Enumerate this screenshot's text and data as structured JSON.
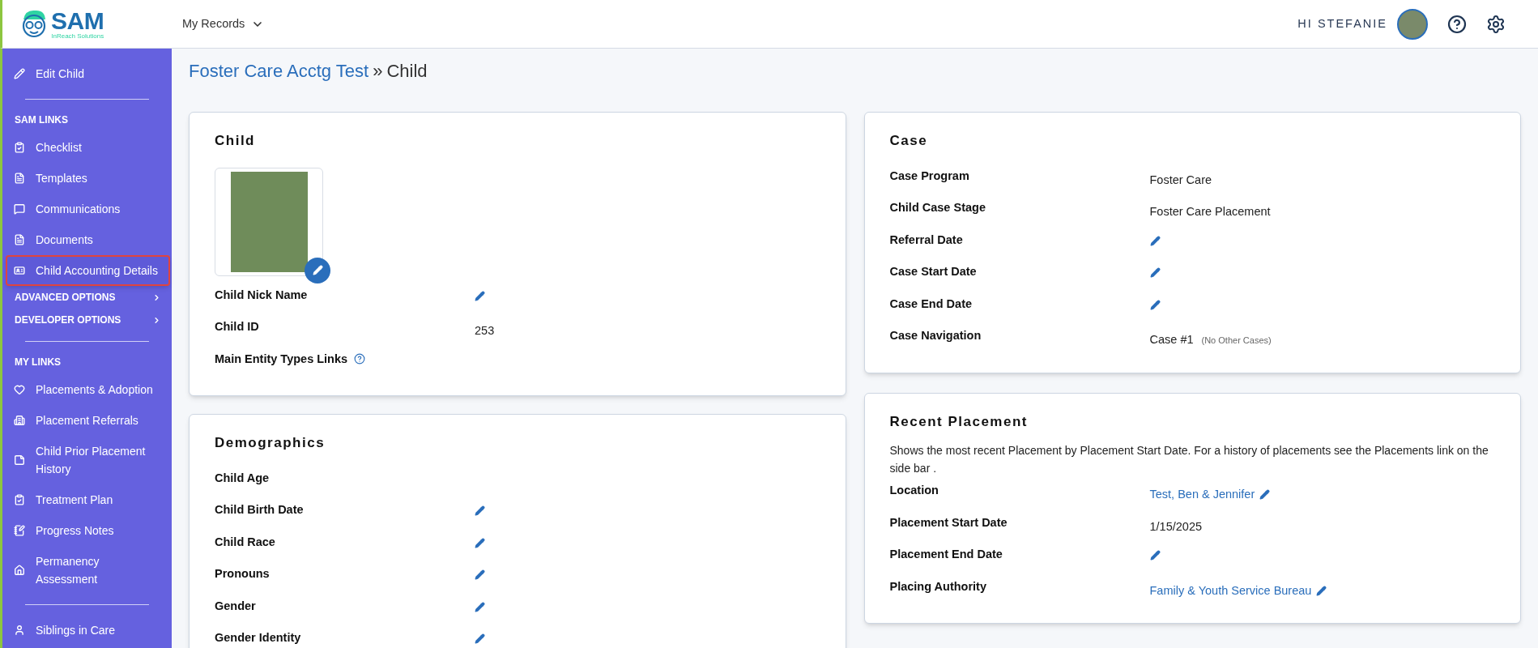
{
  "header": {
    "logo": {
      "name": "SAM",
      "tagline": "InReach Solutions"
    },
    "menu": "My Records",
    "greeting": "HI STEFANIE"
  },
  "sidebar": [
    {
      "kind": "link",
      "label": "Edit Child",
      "selected": false
    },
    {
      "kind": "divider"
    },
    {
      "kind": "heading",
      "label": "SAM LINKS"
    },
    {
      "kind": "link",
      "label": "Checklist",
      "selected": false
    },
    {
      "kind": "link",
      "label": "Templates",
      "selected": false
    },
    {
      "kind": "link",
      "label": "Communications",
      "selected": false
    },
    {
      "kind": "link",
      "label": "Documents",
      "selected": false
    },
    {
      "kind": "link",
      "label": "Child Accounting Details",
      "selected": true
    },
    {
      "kind": "expander",
      "label": "ADVANCED OPTIONS",
      "expanded": false
    },
    {
      "kind": "expander",
      "label": "DEVELOPER OPTIONS",
      "expanded": false
    },
    {
      "kind": "divider"
    },
    {
      "kind": "heading",
      "label": "MY LINKS"
    },
    {
      "kind": "link",
      "label": "Placements & Adoption",
      "selected": false
    },
    {
      "kind": "link",
      "label": "Placement Referrals",
      "selected": false
    },
    {
      "kind": "link",
      "label": "Child Prior Placement History",
      "selected": false
    },
    {
      "kind": "link",
      "label": "Treatment Plan",
      "selected": false
    },
    {
      "kind": "link",
      "label": "Progress Notes",
      "selected": false
    },
    {
      "kind": "link",
      "label": "Permanency Assessment",
      "selected": false
    },
    {
      "kind": "divider"
    },
    {
      "kind": "link",
      "label": "Siblings in Care",
      "selected": false
    }
  ],
  "breadcrumb": {
    "link": "Foster Care Acctg Test",
    "separator": "»",
    "current": "Child"
  },
  "left_cards": [
    {
      "title": "Child",
      "photo": true,
      "fields": [
        {
          "label": "Child Nick Name",
          "editable": true
        },
        {
          "label": "Child ID",
          "value": "253",
          "editable": false
        },
        {
          "label": "Main Entity Types Links",
          "help": true,
          "editable": false
        }
      ]
    },
    {
      "title": "Demographics",
      "photo": false,
      "fields": [
        {
          "label": "Child Age",
          "editable": false
        },
        {
          "label": "Child Birth Date",
          "editable": true
        },
        {
          "label": "Child Race",
          "editable": true
        },
        {
          "label": "Pronouns",
          "editable": true
        },
        {
          "label": "Gender",
          "editable": true
        },
        {
          "label": "Gender Identity",
          "editable": true
        }
      ]
    }
  ],
  "right_cards": [
    {
      "title": "Case",
      "fields": [
        {
          "label": "Case Program",
          "value": "Foster Care",
          "editable": false
        },
        {
          "label": "Child Case Stage",
          "value": "Foster Care Placement",
          "editable": false
        },
        {
          "label": "Referral Date",
          "editable": true
        },
        {
          "label": "Case Start Date",
          "editable": true
        },
        {
          "label": "Case End Date",
          "editable": true
        },
        {
          "label": "Case Navigation",
          "value": "Case #1",
          "note": "(No Other Cases)",
          "editable": false
        }
      ]
    },
    {
      "title": "Recent Placement",
      "description": "Shows the most recent Placement by Placement Start Date. For a history of placements see the Placements link on the side bar .",
      "fields": [
        {
          "label": "Location",
          "value": "Test, Ben & Jennifer",
          "link": true,
          "editable": true
        },
        {
          "label": "Placement Start Date",
          "value": "1/15/2025",
          "editable": false
        },
        {
          "label": "Placement End Date",
          "editable": true
        },
        {
          "label": "Placing Authority",
          "value": "Family & Youth Service Bureau",
          "link": true,
          "editable": true
        }
      ]
    }
  ]
}
